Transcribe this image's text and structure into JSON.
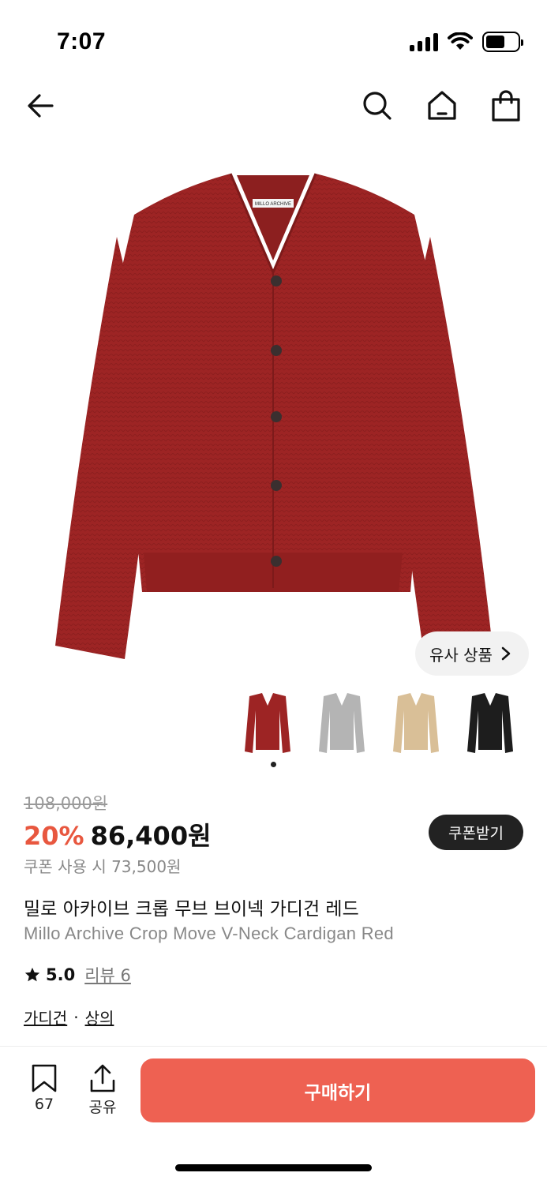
{
  "status_bar": {
    "time": "7:07"
  },
  "nav": {
    "back_icon": "arrow-left-icon",
    "search_icon": "search-icon",
    "home_icon": "home-icon",
    "bag_icon": "shopping-bag-icon"
  },
  "product": {
    "main_image": "red-cardigan",
    "brand_tag": "MILLO ARCHIVE",
    "color_hex": "#9d2424",
    "similar_label": "유사 상품",
    "thumbnails": [
      {
        "color": "#9d2424",
        "name": "red"
      },
      {
        "color": "#b4b4b4",
        "name": "gray"
      },
      {
        "color": "#d9bf97",
        "name": "beige"
      },
      {
        "color": "#1d1d1d",
        "name": "black"
      }
    ],
    "original_price": "108,000원",
    "discount": "20%",
    "final_price": "86,400원",
    "coupon_label": "쿠폰받기",
    "coupon_price": "쿠폰 사용 시 73,500원",
    "name_ko": "밀로 아카이브 크롭 무브 브이넥 가디건 레드",
    "name_en": "Millo Archive Crop Move V-Neck Cardigan Red",
    "rating": "5.0",
    "review_label": "리뷰 6",
    "categories": [
      "가디건",
      "상의"
    ],
    "category_separator": "·"
  },
  "bottom_bar": {
    "bookmark_count": "67",
    "share_label": "공유",
    "buy_label": "구매하기"
  }
}
